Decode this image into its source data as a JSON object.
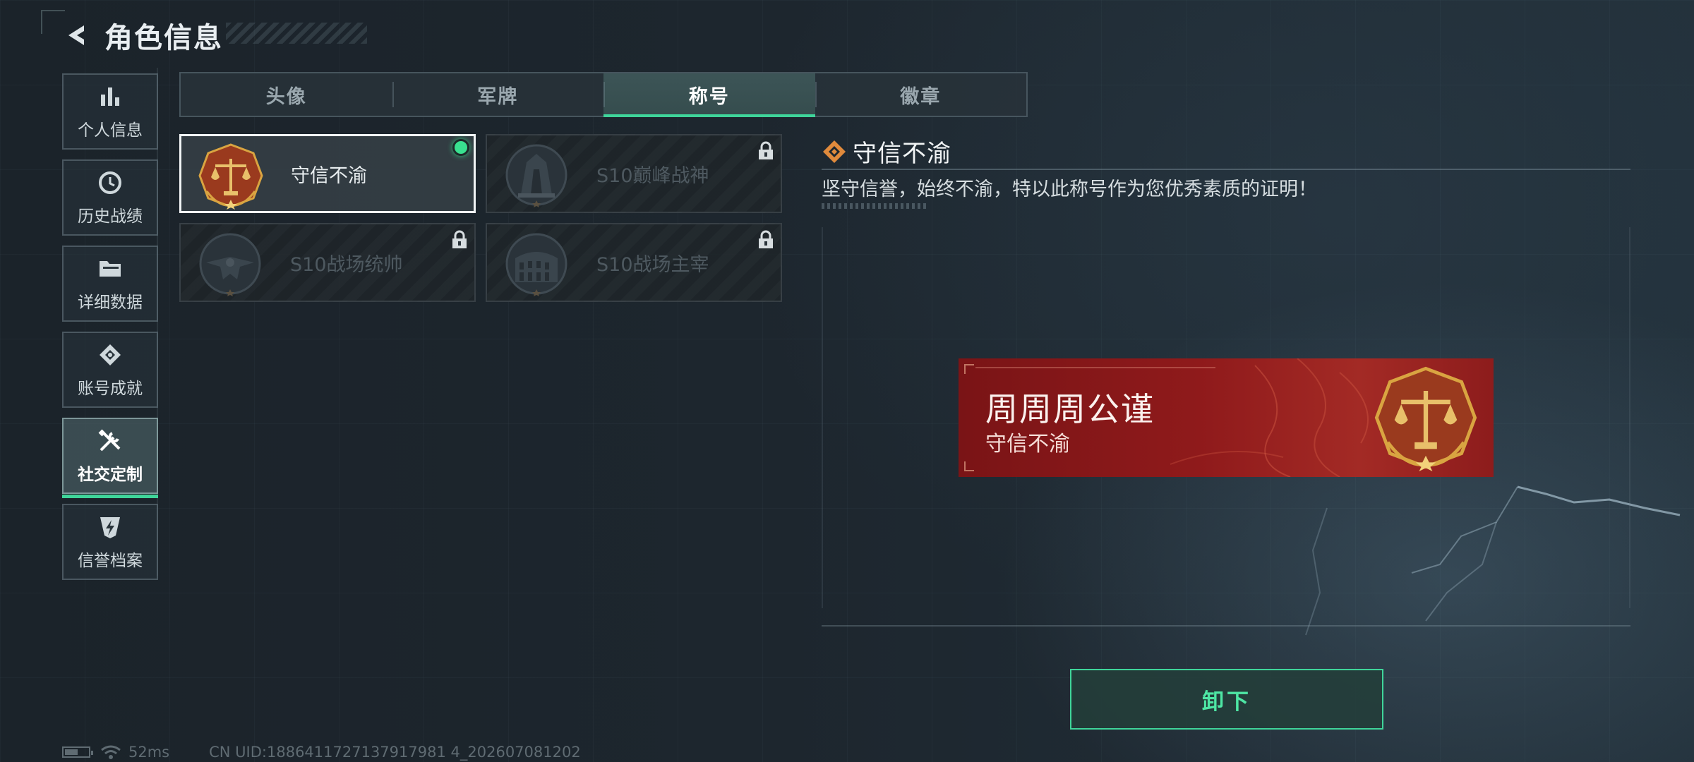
{
  "header": {
    "title": "角色信息"
  },
  "sidebar": {
    "items": [
      {
        "label": "个人信息",
        "icon": "bar-chart-icon",
        "active": false
      },
      {
        "label": "历史战绩",
        "icon": "history-clock-icon",
        "active": false
      },
      {
        "label": "详细数据",
        "icon": "folder-icon",
        "active": false
      },
      {
        "label": "账号成就",
        "icon": "achievement-icon",
        "active": false
      },
      {
        "label": "社交定制",
        "icon": "tools-icon",
        "active": true
      },
      {
        "label": "信誉档案",
        "icon": "shield-bolt-icon",
        "active": false
      }
    ]
  },
  "tabs": [
    {
      "label": "头像",
      "active": false
    },
    {
      "label": "军牌",
      "active": false
    },
    {
      "label": "称号",
      "active": true
    },
    {
      "label": "徽章",
      "active": false
    }
  ],
  "titles": [
    {
      "name": "守信不渝",
      "locked": false,
      "equipped": true,
      "emblem": "scales-emblem"
    },
    {
      "name": "S10巅峰战神",
      "locked": true,
      "equipped": false,
      "emblem": "building-emblem"
    },
    {
      "name": "S10战场统帅",
      "locked": true,
      "equipped": false,
      "emblem": "aircraft-emblem"
    },
    {
      "name": "S10战场主宰",
      "locked": true,
      "equipped": false,
      "emblem": "colosseum-emblem"
    }
  ],
  "detail": {
    "name": "守信不渝",
    "description": "坚守信誉，始终不渝，特以此称号作为您优秀素质的证明！"
  },
  "banner": {
    "player_name": "周周周公谨",
    "title": "守信不渝"
  },
  "unequip_label": "卸下",
  "status": {
    "latency": "52ms",
    "battery_level": 0.55,
    "uid": "CN UID:1886411727137917981 4_202607081202"
  },
  "colors": {
    "accent": "#3fd59a",
    "banner_red": "#8f1a1b",
    "gold": "#d9a441"
  }
}
